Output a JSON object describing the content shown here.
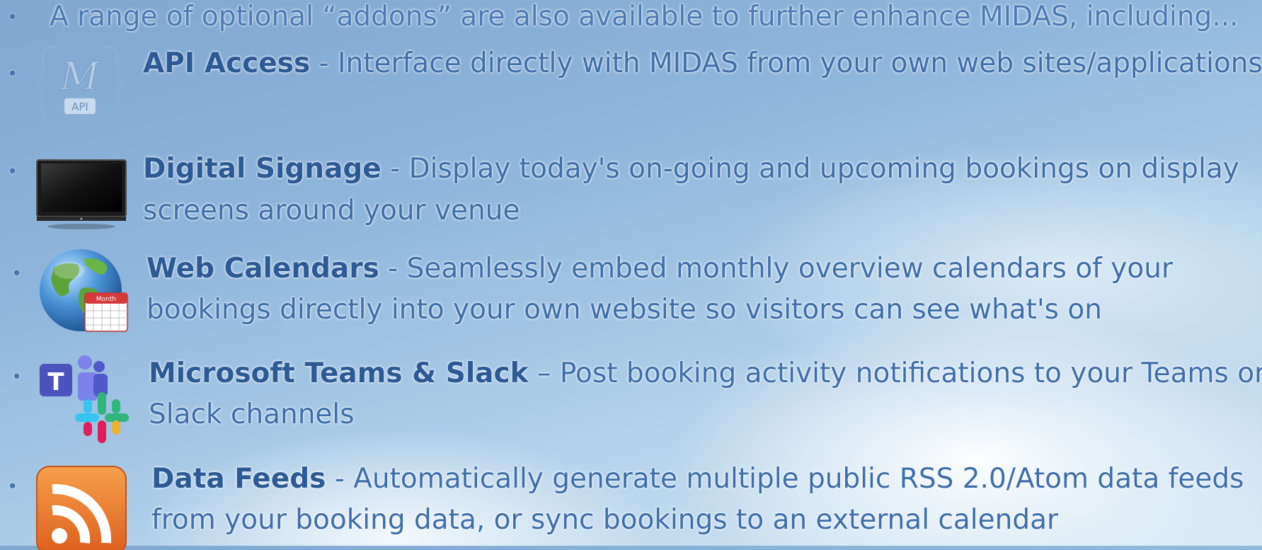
{
  "intro": "A range of optional “addons” are also available to further enhance MIDAS, including...",
  "items": [
    {
      "icon": "api-icon",
      "title": "API Access",
      "sep": " - ",
      "lines": [
        "Interface directly with MIDAS from your own web sites/applications"
      ]
    },
    {
      "icon": "tv-icon",
      "title": "Digital Signage",
      "sep": " - ",
      "lines": [
        "Display today's on-going and upcoming bookings on display",
        "screens around your venue"
      ]
    },
    {
      "icon": "globe-calendar-icon",
      "title": "Web Calendars",
      "sep": " - ",
      "lines": [
        "Seamlessly embed monthly overview calendars of your",
        "bookings directly into your own website so visitors can see what's on"
      ]
    },
    {
      "icon": "teams-slack-icon",
      "title": "Microsoft Teams & Slack",
      "sep": " – ",
      "lines": [
        "Post booking activity notifications to your Teams or",
        "Slack channels"
      ]
    },
    {
      "icon": "rss-icon",
      "title": "Data Feeds",
      "sep": " - ",
      "lines": [
        "Automatically generate multiple public RSS 2.0/Atom data feeds",
        "from your booking data, or sync bookings to an external calendar"
      ]
    }
  ],
  "badges": {
    "api_letter": "M",
    "api_label": "API",
    "teams_letter": "T",
    "calendar_label": "Month"
  },
  "colors": {
    "text": "#3d6faa",
    "title": "#2c5a95",
    "rss": "#e8702a",
    "teams": "#5b5fc7"
  }
}
